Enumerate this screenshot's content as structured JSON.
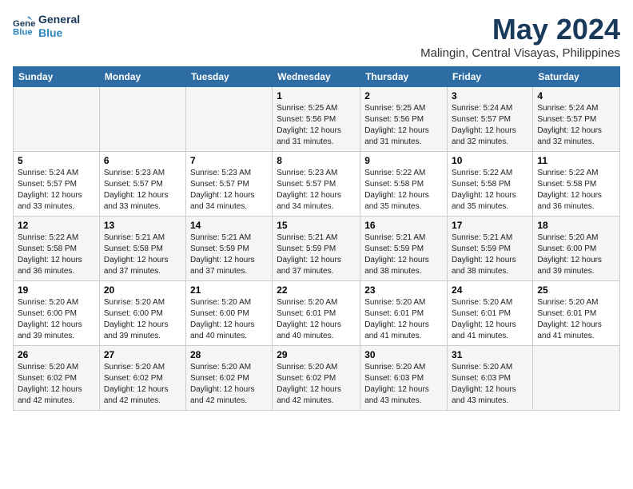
{
  "logo": {
    "line1": "General",
    "line2": "Blue"
  },
  "title": "May 2024",
  "subtitle": "Malingin, Central Visayas, Philippines",
  "headers": [
    "Sunday",
    "Monday",
    "Tuesday",
    "Wednesday",
    "Thursday",
    "Friday",
    "Saturday"
  ],
  "weeks": [
    [
      {
        "day": "",
        "info": ""
      },
      {
        "day": "",
        "info": ""
      },
      {
        "day": "",
        "info": ""
      },
      {
        "day": "1",
        "info": "Sunrise: 5:25 AM\nSunset: 5:56 PM\nDaylight: 12 hours\nand 31 minutes."
      },
      {
        "day": "2",
        "info": "Sunrise: 5:25 AM\nSunset: 5:56 PM\nDaylight: 12 hours\nand 31 minutes."
      },
      {
        "day": "3",
        "info": "Sunrise: 5:24 AM\nSunset: 5:57 PM\nDaylight: 12 hours\nand 32 minutes."
      },
      {
        "day": "4",
        "info": "Sunrise: 5:24 AM\nSunset: 5:57 PM\nDaylight: 12 hours\nand 32 minutes."
      }
    ],
    [
      {
        "day": "5",
        "info": "Sunrise: 5:24 AM\nSunset: 5:57 PM\nDaylight: 12 hours\nand 33 minutes."
      },
      {
        "day": "6",
        "info": "Sunrise: 5:23 AM\nSunset: 5:57 PM\nDaylight: 12 hours\nand 33 minutes."
      },
      {
        "day": "7",
        "info": "Sunrise: 5:23 AM\nSunset: 5:57 PM\nDaylight: 12 hours\nand 34 minutes."
      },
      {
        "day": "8",
        "info": "Sunrise: 5:23 AM\nSunset: 5:57 PM\nDaylight: 12 hours\nand 34 minutes."
      },
      {
        "day": "9",
        "info": "Sunrise: 5:22 AM\nSunset: 5:58 PM\nDaylight: 12 hours\nand 35 minutes."
      },
      {
        "day": "10",
        "info": "Sunrise: 5:22 AM\nSunset: 5:58 PM\nDaylight: 12 hours\nand 35 minutes."
      },
      {
        "day": "11",
        "info": "Sunrise: 5:22 AM\nSunset: 5:58 PM\nDaylight: 12 hours\nand 36 minutes."
      }
    ],
    [
      {
        "day": "12",
        "info": "Sunrise: 5:22 AM\nSunset: 5:58 PM\nDaylight: 12 hours\nand 36 minutes."
      },
      {
        "day": "13",
        "info": "Sunrise: 5:21 AM\nSunset: 5:58 PM\nDaylight: 12 hours\nand 37 minutes."
      },
      {
        "day": "14",
        "info": "Sunrise: 5:21 AM\nSunset: 5:59 PM\nDaylight: 12 hours\nand 37 minutes."
      },
      {
        "day": "15",
        "info": "Sunrise: 5:21 AM\nSunset: 5:59 PM\nDaylight: 12 hours\nand 37 minutes."
      },
      {
        "day": "16",
        "info": "Sunrise: 5:21 AM\nSunset: 5:59 PM\nDaylight: 12 hours\nand 38 minutes."
      },
      {
        "day": "17",
        "info": "Sunrise: 5:21 AM\nSunset: 5:59 PM\nDaylight: 12 hours\nand 38 minutes."
      },
      {
        "day": "18",
        "info": "Sunrise: 5:20 AM\nSunset: 6:00 PM\nDaylight: 12 hours\nand 39 minutes."
      }
    ],
    [
      {
        "day": "19",
        "info": "Sunrise: 5:20 AM\nSunset: 6:00 PM\nDaylight: 12 hours\nand 39 minutes."
      },
      {
        "day": "20",
        "info": "Sunrise: 5:20 AM\nSunset: 6:00 PM\nDaylight: 12 hours\nand 39 minutes."
      },
      {
        "day": "21",
        "info": "Sunrise: 5:20 AM\nSunset: 6:00 PM\nDaylight: 12 hours\nand 40 minutes."
      },
      {
        "day": "22",
        "info": "Sunrise: 5:20 AM\nSunset: 6:01 PM\nDaylight: 12 hours\nand 40 minutes."
      },
      {
        "day": "23",
        "info": "Sunrise: 5:20 AM\nSunset: 6:01 PM\nDaylight: 12 hours\nand 41 minutes."
      },
      {
        "day": "24",
        "info": "Sunrise: 5:20 AM\nSunset: 6:01 PM\nDaylight: 12 hours\nand 41 minutes."
      },
      {
        "day": "25",
        "info": "Sunrise: 5:20 AM\nSunset: 6:01 PM\nDaylight: 12 hours\nand 41 minutes."
      }
    ],
    [
      {
        "day": "26",
        "info": "Sunrise: 5:20 AM\nSunset: 6:02 PM\nDaylight: 12 hours\nand 42 minutes."
      },
      {
        "day": "27",
        "info": "Sunrise: 5:20 AM\nSunset: 6:02 PM\nDaylight: 12 hours\nand 42 minutes."
      },
      {
        "day": "28",
        "info": "Sunrise: 5:20 AM\nSunset: 6:02 PM\nDaylight: 12 hours\nand 42 minutes."
      },
      {
        "day": "29",
        "info": "Sunrise: 5:20 AM\nSunset: 6:02 PM\nDaylight: 12 hours\nand 42 minutes."
      },
      {
        "day": "30",
        "info": "Sunrise: 5:20 AM\nSunset: 6:03 PM\nDaylight: 12 hours\nand 43 minutes."
      },
      {
        "day": "31",
        "info": "Sunrise: 5:20 AM\nSunset: 6:03 PM\nDaylight: 12 hours\nand 43 minutes."
      },
      {
        "day": "",
        "info": ""
      }
    ]
  ]
}
